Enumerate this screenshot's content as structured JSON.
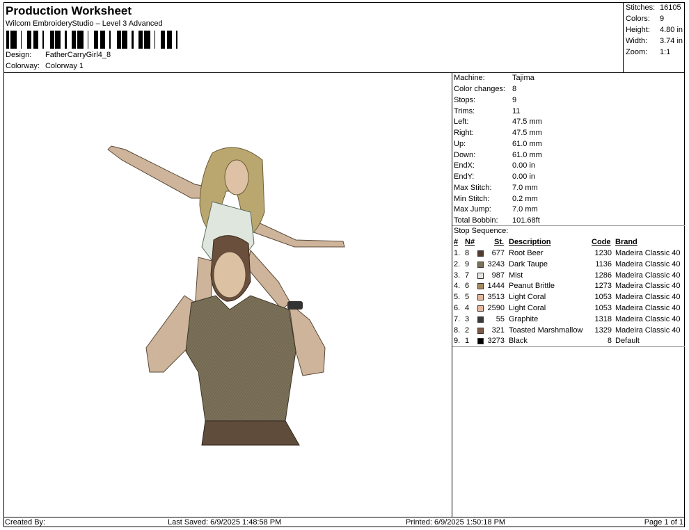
{
  "header": {
    "title": "Production Worksheet",
    "subtitle": "Wilcom EmbroideryStudio – Level 3 Advanced",
    "design_label": "Design:",
    "design_value": "FatherCarryGirl4_8",
    "colorway_label": "Colorway:",
    "colorway_value": "Colorway 1"
  },
  "stats": [
    {
      "label": "Stitches:",
      "value": "16105"
    },
    {
      "label": "Colors:",
      "value": "9"
    },
    {
      "label": "Height:",
      "value": "4.80 in"
    },
    {
      "label": "Width:",
      "value": "3.74 in"
    },
    {
      "label": "Zoom:",
      "value": "1:1"
    }
  ],
  "machine_info": [
    {
      "label": "Machine:",
      "value": "Tajima"
    },
    {
      "label": "Color changes:",
      "value": "8"
    },
    {
      "label": "Stops:",
      "value": "9"
    },
    {
      "label": "Trims:",
      "value": "11"
    },
    {
      "label": "Left:",
      "value": "47.5 mm"
    },
    {
      "label": "Right:",
      "value": "47.5 mm"
    },
    {
      "label": "Up:",
      "value": "61.0 mm"
    },
    {
      "label": "Down:",
      "value": "61.0 mm"
    },
    {
      "label": "EndX:",
      "value": "0.00 in"
    },
    {
      "label": "EndY:",
      "value": "0.00 in"
    },
    {
      "label": "Max Stitch:",
      "value": "7.0 mm"
    },
    {
      "label": "Min Stitch:",
      "value": "0.2 mm"
    },
    {
      "label": "Max Jump:",
      "value": "7.0 mm"
    },
    {
      "label": "Total Bobbin:",
      "value": "101.68ft"
    }
  ],
  "stop_sequence": {
    "title": "Stop Sequence:",
    "headers": {
      "num": "#",
      "n": "N#",
      "st": "St.",
      "desc": "Description",
      "code": "Code",
      "brand": "Brand"
    },
    "rows": [
      {
        "num": "1.",
        "n": "8",
        "st": "677",
        "desc": "Root Beer",
        "code": "1230",
        "brand": "Madeira Classic 40",
        "color": "#4f3c2e"
      },
      {
        "num": "2.",
        "n": "9",
        "st": "3243",
        "desc": "Dark Taupe",
        "code": "1136",
        "brand": "Madeira Classic 40",
        "color": "#7b7058"
      },
      {
        "num": "3.",
        "n": "7",
        "st": "987",
        "desc": "Mist",
        "code": "1286",
        "brand": "Madeira Classic 40",
        "color": "#e2e6df"
      },
      {
        "num": "4.",
        "n": "6",
        "st": "1444",
        "desc": "Peanut Brittle",
        "code": "1273",
        "brand": "Madeira Classic 40",
        "color": "#a58a5e"
      },
      {
        "num": "5.",
        "n": "5",
        "st": "3513",
        "desc": "Light Coral",
        "code": "1053",
        "brand": "Madeira Classic 40",
        "color": "#e4b79c"
      },
      {
        "num": "6.",
        "n": "4",
        "st": "2590",
        "desc": "Light Coral",
        "code": "1053",
        "brand": "Madeira Classic 40",
        "color": "#e4b79c"
      },
      {
        "num": "7.",
        "n": "3",
        "st": "55",
        "desc": "Graphite",
        "code": "1318",
        "brand": "Madeira Classic 40",
        "color": "#3a3a3a"
      },
      {
        "num": "8.",
        "n": "2",
        "st": "321",
        "desc": "Toasted Marshmallow",
        "code": "1329",
        "brand": "Madeira Classic 40",
        "color": "#7a5a48"
      },
      {
        "num": "9.",
        "n": "1",
        "st": "3273",
        "desc": "Black",
        "code": "8",
        "brand": "Default",
        "color": "#000000"
      }
    ]
  },
  "footer": {
    "created_by": "Created By:",
    "last_saved": "Last Saved: 6/9/2025 1:48:58 PM",
    "printed": "Printed: 6/9/2025 1:50:18 PM",
    "page": "Page 1 of 1"
  }
}
